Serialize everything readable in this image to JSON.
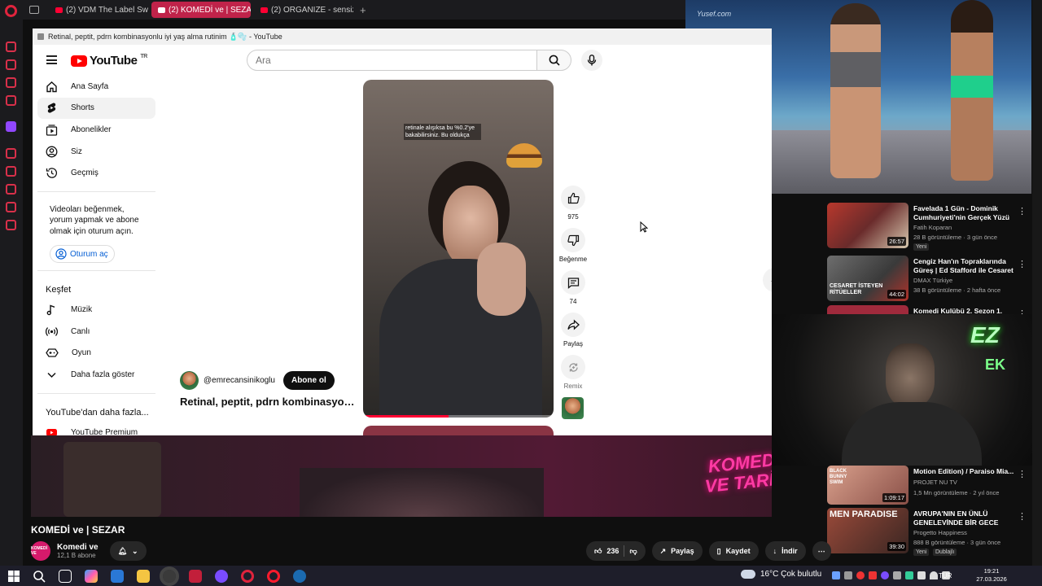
{
  "browser": {
    "tabs": [
      {
        "label": "(2) VDM The Label Swimw"
      },
      {
        "label": "(2) KOMEDİ ve | SEZAR -",
        "active": true
      },
      {
        "label": "(2) ORGANIZE - sensiz [Cl"
      }
    ],
    "new_tab": "+"
  },
  "window": {
    "title": "Retinal, peptit, pdrn kombinasyonlu iyi yaş alma rutinim 🧴🫧 - YouTube"
  },
  "youtube": {
    "logo": "YouTube",
    "region": "TR",
    "search_placeholder": "Ara",
    "nav": [
      {
        "label": "Ana Sayfa",
        "icon": "home-icon"
      },
      {
        "label": "Shorts",
        "icon": "shorts-icon",
        "selected": true
      },
      {
        "label": "Abonelikler",
        "icon": "subscriptions-icon"
      },
      {
        "label": "Siz",
        "icon": "you-icon"
      },
      {
        "label": "Geçmiş",
        "icon": "history-icon"
      }
    ],
    "signin_prompt": "Videoları beğenmek, yorum yapmak ve abone olmak için oturum açın.",
    "signin_button": "Oturum aç",
    "explore_heading": "Keşfet",
    "explore": [
      {
        "label": "Müzik",
        "icon": "music-icon"
      },
      {
        "label": "Canlı",
        "icon": "live-icon"
      },
      {
        "label": "Oyun",
        "icon": "gaming-icon"
      },
      {
        "label": "Daha fazla göster",
        "icon": "chevron-down-icon"
      }
    ],
    "more_heading": "YouTube'dan daha fazla...",
    "premium": "YouTube Premium"
  },
  "short": {
    "caption": "retinale alışıksa bu %0.2'ye bakabilirsiniz. Bu oldukça",
    "channel": "@emrecansinikoglu",
    "subscribe": "Abone ol",
    "title": "Retinal, peptit, pdrn kombinasyonlu iyi yaş alma rutinim",
    "progress": 0.45,
    "actions": {
      "likes": "975",
      "dislike": "Beğenme",
      "comments": "74",
      "share": "Paylaş",
      "remix": "Remix"
    }
  },
  "overlay": {
    "runway_watermark": "Yusef.com"
  },
  "recommendations": [
    {
      "title": "Favelada 1 Gün - Dominik Cumhuriyeti'nin Gerçek Yüzü",
      "channel": "Fatih Koparan",
      "meta": "28 B görüntüleme · 3 gün önce",
      "duration": "26:57",
      "badge": "Yeni",
      "color": "#8c3a2c"
    },
    {
      "title": "Cengiz Han'ın Topraklarında Güreş | Ed Stafford ile Cesaret ...",
      "channel": "DMAX Türkiye",
      "meta": "38 B görüntüleme · 2 hafta önce",
      "duration": "44:02",
      "thumb_text": "CESARET İSTEYEN RİTÜELLER",
      "color": "#5a5a5a"
    },
    {
      "title": "Komedi Kulübü 2. Sezon 1.",
      "channel": "",
      "meta": "",
      "duration": "",
      "color": "#a02a3c"
    },
    {
      "title": "Motion Edition) / Paraiso Mia...",
      "channel": "PROJET NU TV",
      "meta": "1,5 Mn görüntüleme · 2 yıl önce",
      "duration": "1:09:17",
      "thumb_text": "BLACK BUNNY SWIM",
      "color": "#b86c6c"
    },
    {
      "title": "AVRUPA'NIN EN ÜNLÜ GENELEVİNDE BİR GECE",
      "channel": "Progetto Happiness",
      "meta": "888 B görüntüleme · 3 gün önce",
      "duration": "39:30",
      "badge": "Yeni",
      "badge2": "Dublajlı",
      "thumb_text": "MEN PARADISE",
      "color": "#7a3b2e"
    }
  ],
  "stream": {
    "neon_text": "KOMEDİ VE TARİH",
    "title": "KOMEDİ ve | SEZAR",
    "channel": "Komedi ve",
    "subs": "12,1 B abone",
    "avatar_text": "KOMEDİ VE",
    "likes": "236",
    "share": "Paylaş",
    "save": "Kaydet",
    "download": "İndir"
  },
  "webcam": {
    "logo": "EZ",
    "logo_sub": "EK"
  },
  "taskbar": {
    "weather": "16°C  Çok bulutlu",
    "lang": "TUR",
    "time": "19:21",
    "date": "27.03.2026"
  }
}
